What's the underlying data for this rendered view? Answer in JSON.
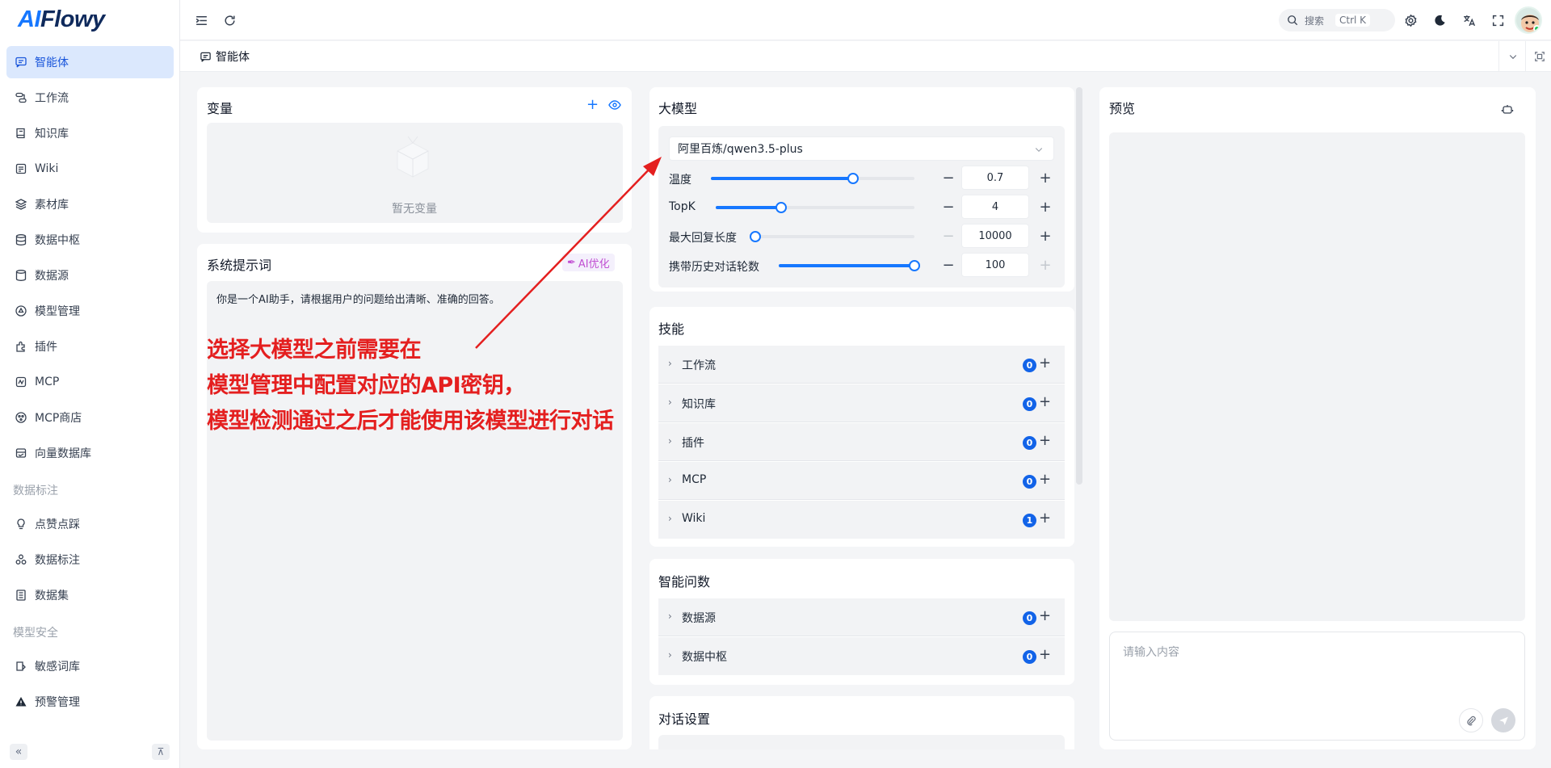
{
  "app": {
    "logo": "AIFlowy"
  },
  "sidebar": {
    "items": [
      {
        "label": "智能体",
        "icon": "chat-icon",
        "active": true
      },
      {
        "label": "工作流",
        "icon": "workflow-icon"
      },
      {
        "label": "知识库",
        "icon": "book-icon"
      },
      {
        "label": "Wiki",
        "icon": "wiki-icon"
      },
      {
        "label": "素材库",
        "icon": "layers-icon"
      },
      {
        "label": "数据中枢",
        "icon": "database-icon"
      },
      {
        "label": "数据源",
        "icon": "datasource-icon"
      },
      {
        "label": "模型管理",
        "icon": "model-icon"
      },
      {
        "label": "插件",
        "icon": "plugin-icon"
      },
      {
        "label": "MCP",
        "icon": "mcp-icon"
      },
      {
        "label": "MCP商店",
        "icon": "store-icon"
      },
      {
        "label": "向量数据库",
        "icon": "vector-db-icon"
      }
    ],
    "group1": "数据标注",
    "group1_items": [
      {
        "label": "点赞点踩",
        "icon": "bulb-icon"
      },
      {
        "label": "数据标注",
        "icon": "annotate-icon"
      },
      {
        "label": "数据集",
        "icon": "dataset-icon"
      }
    ],
    "group2": "模型安全",
    "group2_items": [
      {
        "label": "敏感词库",
        "icon": "sensitive-icon"
      },
      {
        "label": "预警管理",
        "icon": "warning-icon"
      }
    ]
  },
  "header": {
    "search_placeholder": "搜索",
    "search_shortcut": "Ctrl K"
  },
  "tabs": {
    "active": "智能体"
  },
  "variables": {
    "title": "变量",
    "empty": "暂无变量"
  },
  "system_prompt": {
    "title": "系统提示词",
    "ai_button": "AI优化",
    "text": "你是一个AI助手，请根据用户的问题给出清晰、准确的回答。"
  },
  "annotation": {
    "line1": "选择大模型之前需要在",
    "line2": "模型管理中配置对应的API密钥，",
    "line3": "模型检测通过之后才能使用该模型进行对话",
    "color": "#e41f1f"
  },
  "model": {
    "title": "大模型",
    "selected": "阿里百炼/qwen3.5-plus",
    "params": [
      {
        "label": "温度",
        "value": "0.7",
        "fraction": 0.7
      },
      {
        "label": "TopK",
        "value": "4",
        "fraction": 0.33
      },
      {
        "label": "最大回复长度",
        "value": "10000",
        "fraction": 0.0
      },
      {
        "label": "携带历史对话轮数",
        "value": "100",
        "fraction": 1.0
      }
    ]
  },
  "skills": {
    "title": "技能",
    "items": [
      {
        "label": "工作流",
        "count": "0"
      },
      {
        "label": "知识库",
        "count": "0"
      },
      {
        "label": "插件",
        "count": "0"
      },
      {
        "label": "MCP",
        "count": "0"
      },
      {
        "label": "Wiki",
        "count": "1"
      }
    ]
  },
  "smart_query": {
    "title": "智能问数",
    "items": [
      {
        "label": "数据源",
        "count": "0"
      },
      {
        "label": "数据中枢",
        "count": "0"
      }
    ]
  },
  "dialog_settings": {
    "title": "对话设置"
  },
  "preview": {
    "title": "预览",
    "input_placeholder": "请输入内容"
  },
  "colors": {
    "accent": "#1677ff",
    "active_bg": "#dbe8fd",
    "badge": "#1263e8",
    "ai_btn": "#c14fd2"
  }
}
